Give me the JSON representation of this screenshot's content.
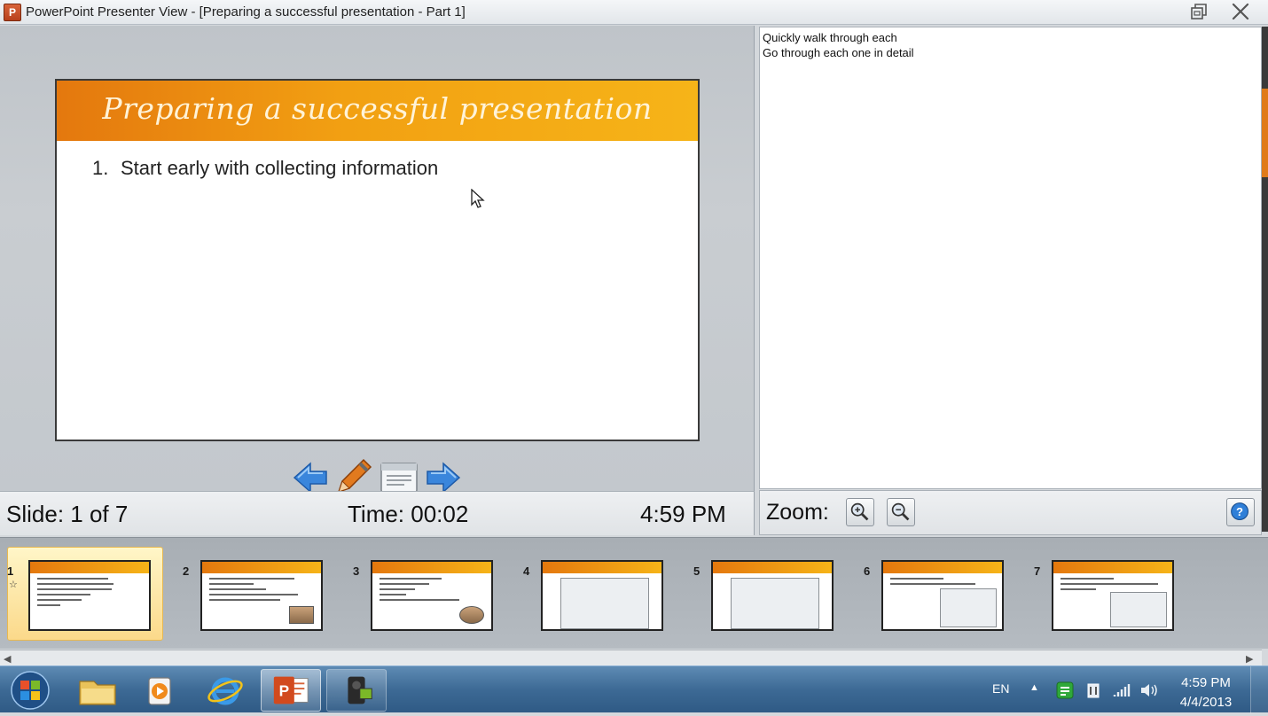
{
  "window": {
    "title": "PowerPoint Presenter View - [Preparing a successful presentation - Part 1]",
    "icon": "powerpoint-icon",
    "controls": [
      "restore-icon",
      "close-icon"
    ]
  },
  "slide": {
    "title": "Preparing a successful presentation",
    "bullet_number": "1.",
    "bullet_text": "Start early with collecting information",
    "banner_color_start": "#e4780e",
    "banner_color_end": "#f6b418"
  },
  "navigation": {
    "buttons": [
      "prev-arrow-icon",
      "pen-icon",
      "screen-icon",
      "next-arrow-icon"
    ]
  },
  "status": {
    "slide_counter": "Slide: 1 of 7",
    "timer": "Time: 00:02",
    "clock": "4:59 PM"
  },
  "notes": {
    "lines": [
      "Quickly walk through each",
      "Go through each one in detail"
    ]
  },
  "zoom": {
    "label": "Zoom:",
    "buttons": [
      "zoom-in-icon",
      "zoom-out-icon"
    ],
    "help": "help-icon"
  },
  "thumbnails": [
    {
      "number": "1",
      "selected": true
    },
    {
      "number": "2",
      "selected": false
    },
    {
      "number": "3",
      "selected": false
    },
    {
      "number": "4",
      "selected": false
    },
    {
      "number": "5",
      "selected": false
    },
    {
      "number": "6",
      "selected": false
    },
    {
      "number": "7",
      "selected": false
    }
  ],
  "taskbar": {
    "apps": [
      "windows-start-icon",
      "file-explorer-icon",
      "media-player-icon",
      "internet-explorer-icon",
      "powerpoint-icon",
      "camera-app-icon"
    ],
    "active_app": "powerpoint-icon",
    "language": "EN",
    "tray_icons": [
      "show-hidden-icons",
      "green-app-icon",
      "network-device-icon",
      "signal-icon",
      "volume-icon"
    ],
    "time": "4:59 PM",
    "date": "4/4/2013"
  },
  "colors": {
    "accent_orange": "#e07b1a",
    "taskbar_blue": "#3d6a95",
    "nav_arrow_blue": "#2f7fd8"
  }
}
